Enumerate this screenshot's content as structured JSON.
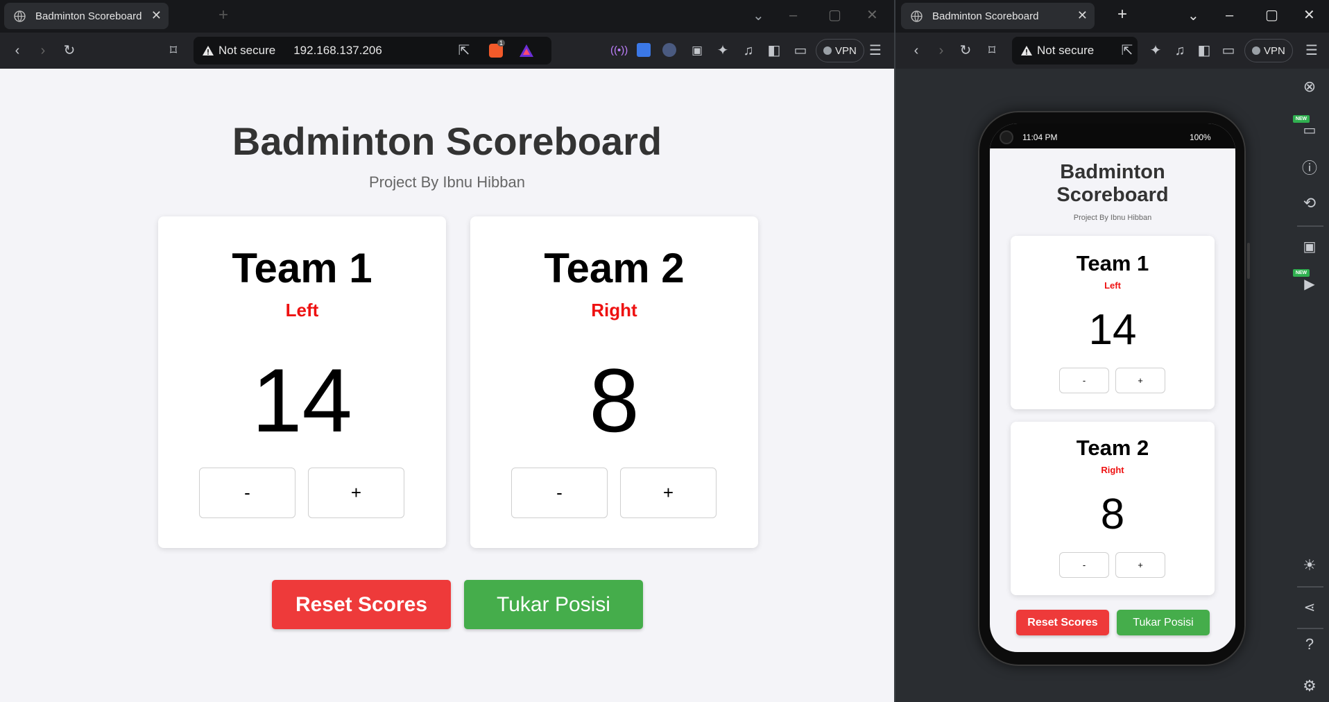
{
  "left_browser": {
    "tab_title": "Badminton Scoreboard",
    "new_tab_glyph": "+",
    "not_secure_label": "Not secure",
    "url": "192.168.137.206",
    "brave_badge_count": "1",
    "vpn_label": "VPN"
  },
  "right_browser": {
    "tab_title": "Badminton Scoreboard",
    "new_tab_glyph": "+",
    "not_secure_label": "Not secure",
    "vpn_label": "VPN",
    "new_badge_text": "NEW"
  },
  "scoreboard": {
    "title": "Badminton Scoreboard",
    "subtitle": "Project By Ibnu Hibban",
    "teams": [
      {
        "name": "Team 1",
        "side": "Left",
        "score": "14",
        "minus": "-",
        "plus": "+"
      },
      {
        "name": "Team 2",
        "side": "Right",
        "score": "8",
        "minus": "-",
        "plus": "+"
      }
    ],
    "reset_label": "Reset Scores",
    "swap_label": "Tukar Posisi"
  },
  "phone": {
    "time": "11:04 PM",
    "battery": "100%",
    "title_line1": "Badminton",
    "title_line2": "Scoreboard"
  },
  "colors": {
    "reset_button": "#ee3a3a",
    "swap_button": "#45ad4b",
    "side_label": "#ee1111",
    "page_background": "#f4f4f8"
  },
  "icons": [
    "globe-icon",
    "close-icon",
    "back-icon",
    "forward-icon",
    "reload-icon",
    "bookmark-icon",
    "warning-icon",
    "share-icon",
    "brave-shield-icon",
    "brave-rewards-icon",
    "extensions-icon",
    "music-icon",
    "sidebar-icon",
    "wallet-icon",
    "menu-icon",
    "camera-icon",
    "translate-icon",
    "cursor-icon",
    "minimize-icon",
    "maximize-icon",
    "chevron-down-icon",
    "responsive-icon",
    "info-icon",
    "rotate-icon",
    "video-icon",
    "brightness-icon",
    "share-network-icon",
    "help-icon",
    "settings-icon"
  ]
}
